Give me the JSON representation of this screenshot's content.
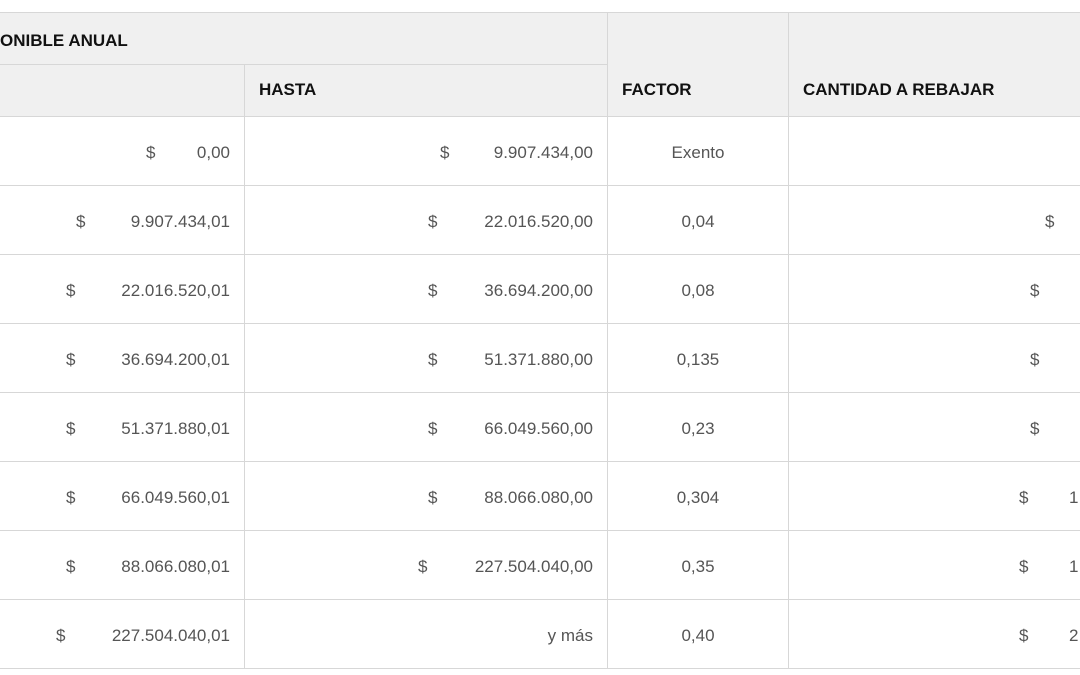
{
  "header": {
    "group_title": "ONIBLE ANUAL",
    "col_hasta": "HASTA",
    "col_factor": "FACTOR",
    "col_cantidad": "CANTIDAD A REBAJAR"
  },
  "rows": [
    {
      "desde_cur": "$",
      "desde": "0,00",
      "hasta_cur": "$",
      "hasta": "9.907.434,00",
      "factor": "Exento",
      "rebajar_cur": "",
      "rebajar": ""
    },
    {
      "desde_cur": "$",
      "desde": "9.907.434,01",
      "hasta_cur": "$",
      "hasta": "22.016.520,00",
      "factor": "0,04",
      "rebajar_cur": "$",
      "rebajar": ""
    },
    {
      "desde_cur": "$",
      "desde": "22.016.520,01",
      "hasta_cur": "$",
      "hasta": "36.694.200,00",
      "factor": "0,08",
      "rebajar_cur": "$",
      "rebajar": ""
    },
    {
      "desde_cur": "$",
      "desde": "36.694.200,01",
      "hasta_cur": "$",
      "hasta": "51.371.880,00",
      "factor": "0,135",
      "rebajar_cur": "$",
      "rebajar": ""
    },
    {
      "desde_cur": "$",
      "desde": "51.371.880,01",
      "hasta_cur": "$",
      "hasta": "66.049.560,00",
      "factor": "0,23",
      "rebajar_cur": "$",
      "rebajar": ""
    },
    {
      "desde_cur": "$",
      "desde": "66.049.560,01",
      "hasta_cur": "$",
      "hasta": "88.066.080,00",
      "factor": "0,304",
      "rebajar_cur": "$",
      "rebajar": "1"
    },
    {
      "desde_cur": "$",
      "desde": "88.066.080,01",
      "hasta_cur": "$",
      "hasta": "227.504.040,00",
      "factor": "0,35",
      "rebajar_cur": "$",
      "rebajar": "1"
    },
    {
      "desde_cur": "$",
      "desde": "227.504.040,01",
      "hasta_cur": "",
      "hasta": "y más",
      "factor": "0,40",
      "rebajar_cur": "$",
      "rebajar": "2"
    }
  ]
}
